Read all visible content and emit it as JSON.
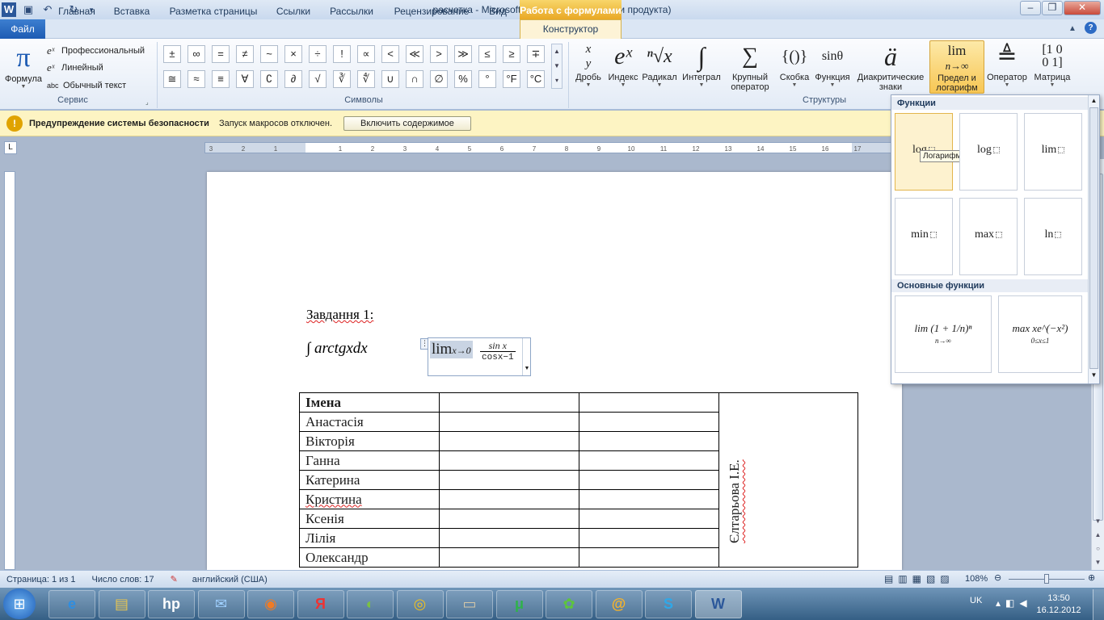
{
  "window": {
    "title": "расчетка - Microsoft Word (Сбой активации продукта)",
    "context_header": "Работа с формулами"
  },
  "tabs": {
    "file": "Файл",
    "items": [
      "Главная",
      "Вставка",
      "Разметка страницы",
      "Ссылки",
      "Рассылки",
      "Рецензирование",
      "Вид"
    ],
    "design": "Конструктор"
  },
  "ribbon": {
    "service": {
      "formula": "Формула",
      "professional": "Профессиональный",
      "linear": "Линейный",
      "plain": "Обычный текст",
      "label": "Сервис",
      "abc": "abc"
    },
    "symbols": {
      "label": "Символы",
      "row1": [
        "±",
        "∞",
        "=",
        "≠",
        "~",
        "×",
        "÷",
        "!",
        "∝",
        "<",
        "≪",
        ">",
        "≫",
        "≤",
        "≥",
        "∓"
      ],
      "row2": [
        "≅",
        "≈",
        "≡",
        "∀",
        "∁",
        "∂",
        "√",
        "∛",
        "∜",
        "∪",
        "∩",
        "∅",
        "%",
        "°",
        "°F",
        "°C"
      ]
    },
    "structures": {
      "label": "Структуры",
      "items": [
        {
          "name": "fraction",
          "label": "Дробь",
          "glyph": "x/y"
        },
        {
          "name": "script",
          "label": "Индекс",
          "glyph": "eˣ"
        },
        {
          "name": "radical",
          "label": "Радикал",
          "glyph": "ⁿ√x"
        },
        {
          "name": "integral",
          "label": "Интеграл",
          "glyph": "∫"
        },
        {
          "name": "large-operator",
          "label": "Крупный оператор",
          "glyph": "∑"
        },
        {
          "name": "bracket",
          "label": "Скобка",
          "glyph": "{()}"
        },
        {
          "name": "function",
          "label": "Функция",
          "glyph": "sinθ"
        },
        {
          "name": "accent",
          "label": "Диакритические знаки",
          "glyph": "ä"
        },
        {
          "name": "limit-log",
          "label": "Предел и логарифм",
          "glyph": "lim"
        },
        {
          "name": "operator",
          "label": "Оператор",
          "glyph": "≜"
        },
        {
          "name": "matrix",
          "label": "Матрица",
          "glyph": "[10 01]"
        }
      ]
    }
  },
  "warning": {
    "title": "Предупреждение системы безопасности",
    "text": "Запуск макросов отключен.",
    "button": "Включить содержимое"
  },
  "ruler": {
    "marks": [
      "3",
      "2",
      "1",
      "",
      "1",
      "2",
      "3",
      "4",
      "5",
      "6",
      "7",
      "8",
      "9",
      "10",
      "11",
      "12",
      "13",
      "14",
      "15",
      "16",
      "17"
    ]
  },
  "document": {
    "heading": "Завдання 1:",
    "integral": "∫ arctgxdx",
    "limit": {
      "op": "lim",
      "sub": "x→0",
      "num": "sin x",
      "den": "cosx−1"
    },
    "table": {
      "header": "Імена",
      "rows": [
        "Анастасія",
        "Вікторія",
        "Ганна",
        "Катерина",
        "Кристина",
        "Ксенія",
        "Лілія",
        "Олександр"
      ],
      "vertical": "Єлтарьова І.Е."
    }
  },
  "gallery": {
    "section1": "Функции",
    "section2": "Основные функции",
    "tooltip": "Логарифм",
    "functions": [
      "log",
      "log",
      "lim",
      "min",
      "max",
      "ln"
    ],
    "basic": [
      "lim (1 + 1/n)ⁿ",
      "max xe^(−x²)"
    ],
    "basic_subs": [
      "n→∞",
      "0≤x≤1"
    ]
  },
  "status": {
    "page": "Страница: 1 из 1",
    "words": "Число слов: 17",
    "lang": "английский (США)",
    "zoom": "108%"
  },
  "tray": {
    "lang": "UK",
    "time": "13:50",
    "date": "16.12.2012"
  },
  "taskbar": [
    "ie",
    "explorer",
    "hp",
    "mail",
    "firefox",
    "yandex",
    "picasa",
    "media",
    "app",
    "utorrent",
    "icq",
    "agent",
    "skype",
    "word"
  ]
}
